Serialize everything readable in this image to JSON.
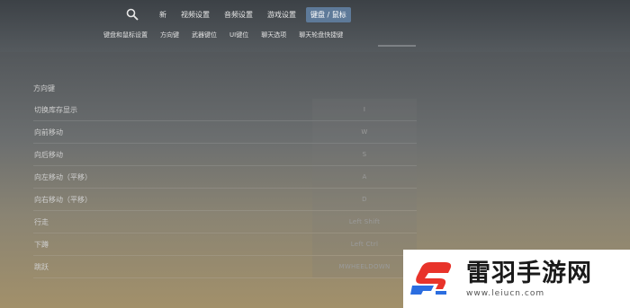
{
  "nav": {
    "items": [
      {
        "label": "新",
        "active": false
      },
      {
        "label": "视频设置",
        "active": false
      },
      {
        "label": "音频设置",
        "active": false
      },
      {
        "label": "游戏设置",
        "active": false
      },
      {
        "label": "键盘 / 鼠标",
        "active": true
      }
    ],
    "active_color": "#5e7a99"
  },
  "subnav": {
    "items": [
      "键盘和鼠标设置",
      "方向键",
      "武器键位",
      "UI键位",
      "聊天选项",
      "聊天轮盘快捷键"
    ]
  },
  "section": {
    "title": "方向键"
  },
  "bindings": [
    {
      "action": "切换库存显示",
      "key": "I"
    },
    {
      "action": "向前移动",
      "key": "W"
    },
    {
      "action": "向后移动",
      "key": "S"
    },
    {
      "action": "向左移动（平移）",
      "key": "A"
    },
    {
      "action": "向右移动（平移）",
      "key": "D"
    },
    {
      "action": "行走",
      "key": "Left Shift"
    },
    {
      "action": "下蹲",
      "key": "Left Ctrl"
    },
    {
      "action": "跳跃",
      "key": "MWHEELDOWN"
    }
  ],
  "watermark": {
    "title": "雷羽手游网",
    "url": "www.leiucn.com",
    "brand_color": "#e8332a",
    "accent_color": "#2b6de0"
  }
}
